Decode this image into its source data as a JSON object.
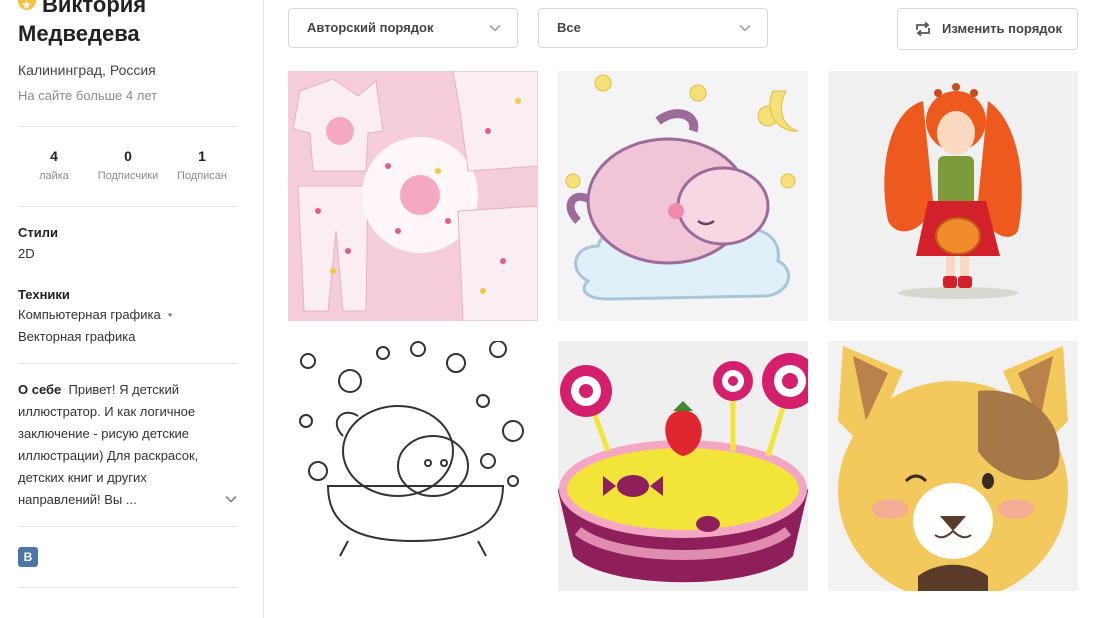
{
  "profile": {
    "name": "Виктория Медведева",
    "location": "Калининград, Россия",
    "since": "На сайте больше 4 лет",
    "stats": [
      {
        "value": "4",
        "label": "лайка"
      },
      {
        "value": "0",
        "label": "Подписчики"
      },
      {
        "value": "1",
        "label": "Подписан"
      }
    ],
    "styles_title": "Стили",
    "styles_value": "2D",
    "techniques_title": "Техники",
    "technique_1": "Компьютерная графика",
    "technique_2": "Векторная графика",
    "about_title": "О себе",
    "about_text": "Привет! Я детский иллюстратор. И как логичное заключение - рисую детские иллюстрации) Для раскрасок, детских книг и других направлений! Вы ...",
    "vk_label": "B"
  },
  "toolbar": {
    "sort_value": "Авторский порядок",
    "filter_value": "Все",
    "reorder_label": "Изменить порядок"
  },
  "gallery": [
    {
      "name": "pajama-pattern-artwork",
      "bg": "#f3c6d2"
    },
    {
      "name": "sheep-on-cloud-artwork",
      "bg": "#f4f4f6"
    },
    {
      "name": "redhead-girl-pumpkin-artwork",
      "bg": "#f0f0f0"
    },
    {
      "name": "sheep-in-bath-coloring-artwork",
      "bg": "#ffffff"
    },
    {
      "name": "candy-bowl-artwork",
      "bg": "#efefef"
    },
    {
      "name": "dog-face-artwork",
      "bg": "#f2f2f2"
    }
  ]
}
